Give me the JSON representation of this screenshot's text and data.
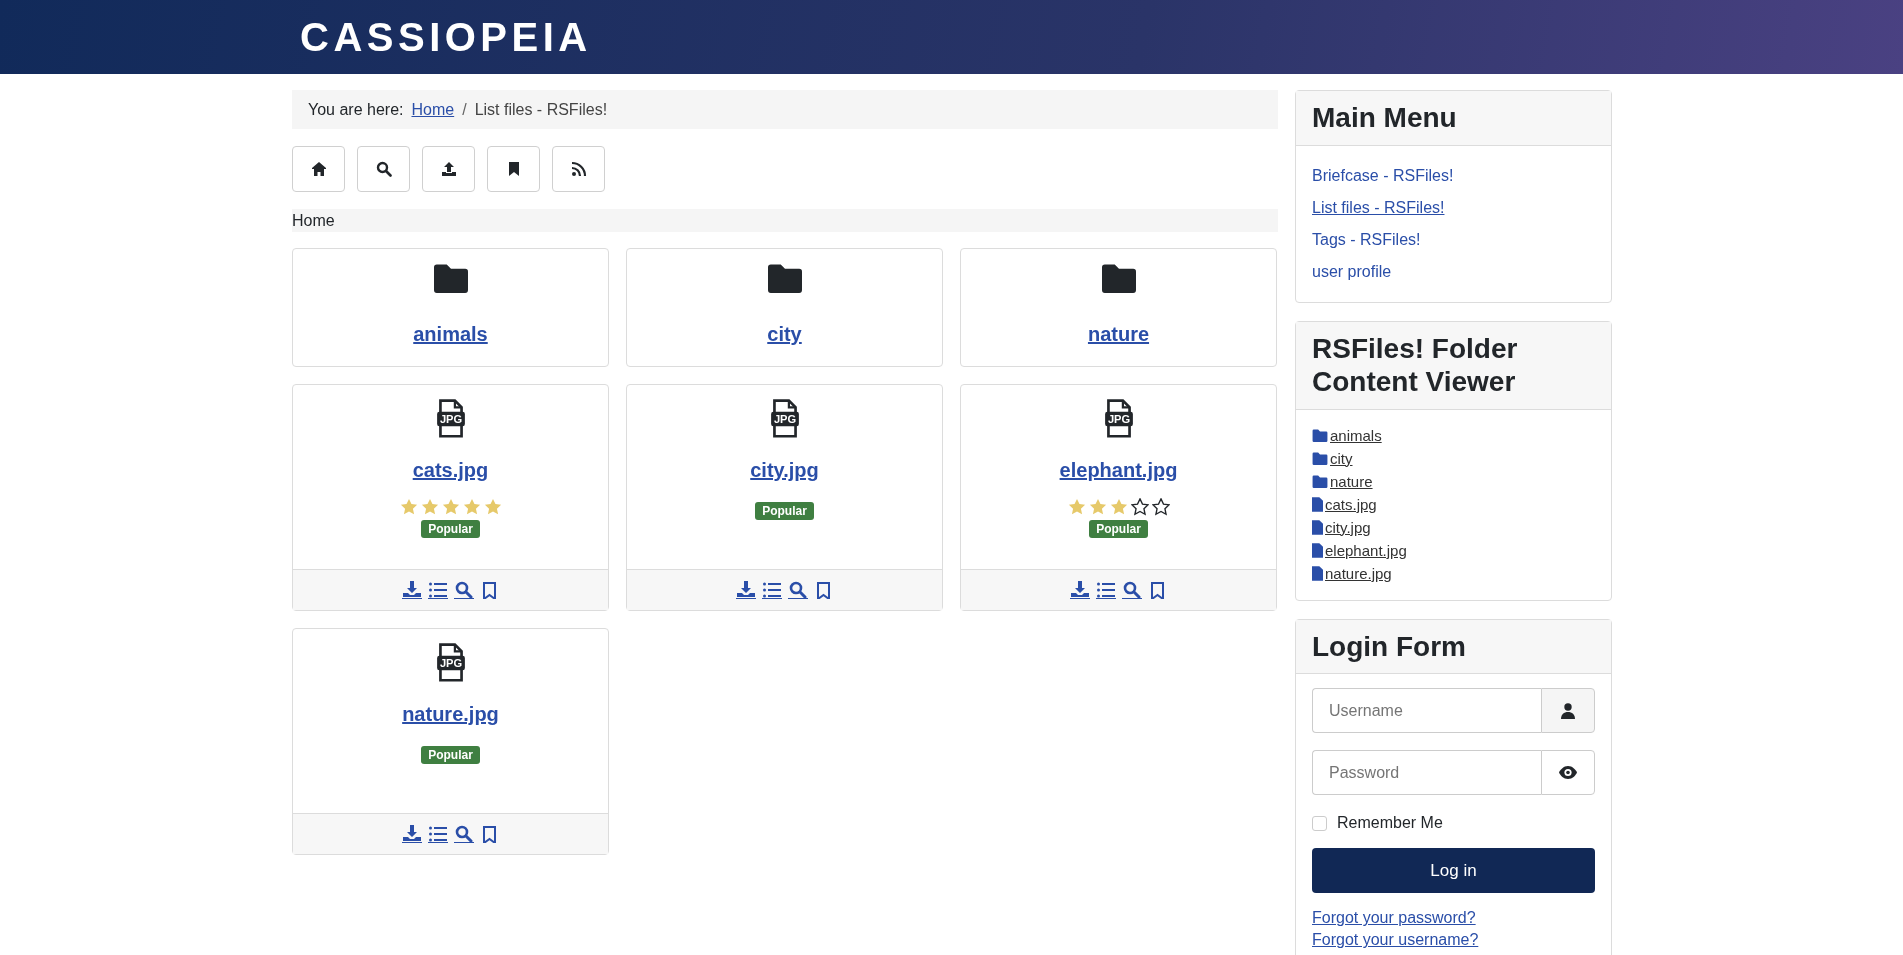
{
  "header": {
    "logo": "CASSIOPEIA"
  },
  "breadcrumb": {
    "label": "You are here:",
    "separator": "/",
    "items": [
      {
        "text": "Home",
        "link": true
      },
      {
        "text": "List files - RSFiles!",
        "link": false
      }
    ]
  },
  "toolbar": [
    {
      "kind": "home"
    },
    {
      "kind": "search"
    },
    {
      "kind": "upload"
    },
    {
      "kind": "bookmark"
    },
    {
      "kind": "rss"
    }
  ],
  "path": "Home",
  "items": [
    {
      "kind": "folder",
      "name": "animals"
    },
    {
      "kind": "folder",
      "name": "city"
    },
    {
      "kind": "folder",
      "name": "nature"
    },
    {
      "kind": "file",
      "icon_text": "JPG",
      "name": "cats.jpg",
      "stars": 5,
      "badge": "Popular"
    },
    {
      "kind": "file",
      "icon_text": "JPG",
      "name": "city.jpg",
      "badge": "Popular"
    },
    {
      "kind": "file",
      "icon_text": "JPG",
      "name": "elephant.jpg",
      "stars": 3,
      "badge": "Popular"
    },
    {
      "kind": "file",
      "icon_text": "JPG",
      "name": "nature.jpg",
      "badge": "Popular"
    }
  ],
  "main_menu": {
    "title": "Main Menu",
    "items": [
      {
        "label": "Briefcase - RSFiles!",
        "selected": false
      },
      {
        "label": "List files - RSFiles!",
        "selected": true
      },
      {
        "label": "Tags - RSFiles!",
        "selected": false
      },
      {
        "label": "user profile",
        "selected": false
      }
    ]
  },
  "folder_viewer": {
    "title": "RSFiles! Folder Content Viewer",
    "entries": [
      {
        "kind": "folder",
        "name": "animals"
      },
      {
        "kind": "folder",
        "name": "city"
      },
      {
        "kind": "folder",
        "name": "nature"
      },
      {
        "kind": "file",
        "name": "cats.jpg"
      },
      {
        "kind": "file",
        "name": "city.jpg"
      },
      {
        "kind": "file",
        "name": "elephant.jpg"
      },
      {
        "kind": "file",
        "name": "nature.jpg"
      }
    ]
  },
  "login": {
    "title": "Login Form",
    "username": {
      "placeholder": "Username"
    },
    "password": {
      "placeholder": "Password"
    },
    "remember": {
      "label": "Remember Me",
      "checked": false
    },
    "button": "Log in",
    "links": [
      "Forgot your password?",
      "Forgot your username?"
    ]
  }
}
